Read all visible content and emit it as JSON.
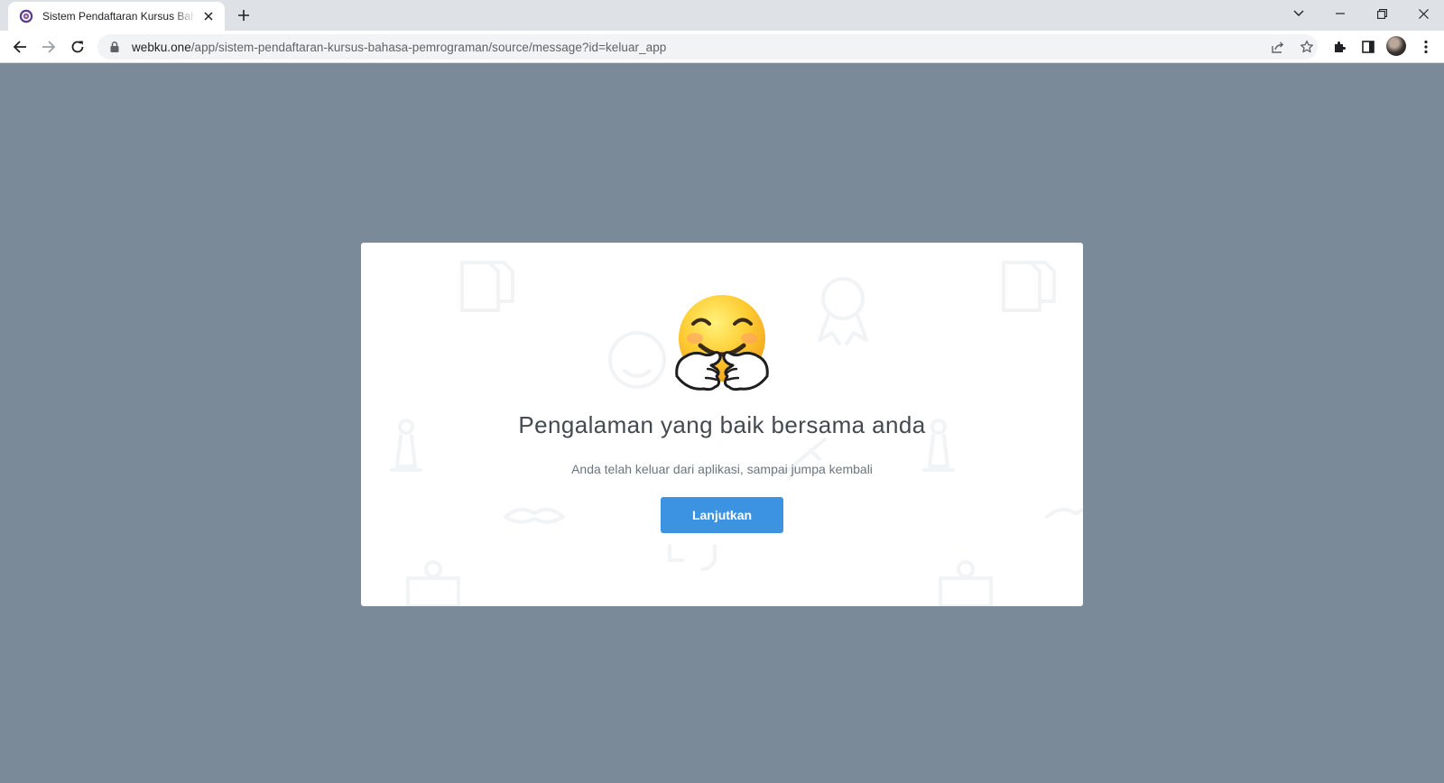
{
  "browser": {
    "tab": {
      "title": "Sistem Pendaftaran Kursus Bahasa Pemrograman",
      "favicon": "app-logo-icon"
    },
    "url": {
      "host": "webku.one",
      "path": "/app/sistem-pendaftaran-kursus-bahasa-pemrograman/source/message?id=keluar_app"
    },
    "accent_colors": {
      "page_background": "#7b8a98",
      "button": "#3c93e2"
    }
  },
  "message": {
    "emoji": "hugging-face-emoji",
    "title": "Pengalaman yang baik bersama anda",
    "subtitle": "Anda telah keluar dari aplikasi, sampai jumpa kembali",
    "button_label": "Lanjutkan"
  }
}
